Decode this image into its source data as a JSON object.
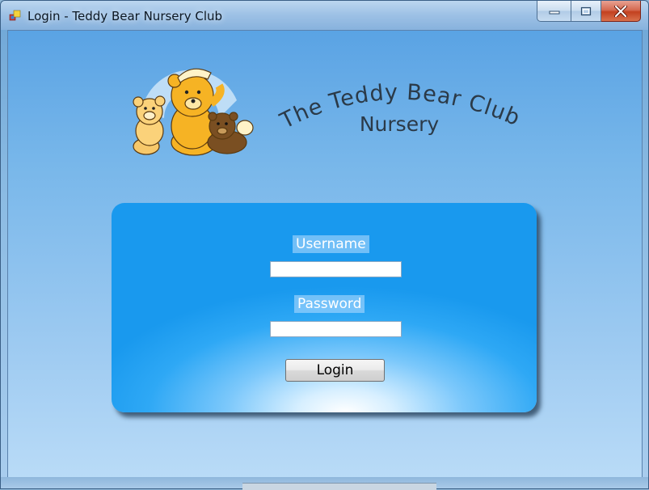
{
  "window": {
    "title": "Login - Teddy Bear Nursery Club",
    "icon": "app-window-icon",
    "controls": {
      "minimize": "minimize-icon",
      "maximize": "maximize-icon",
      "close": "close-icon"
    }
  },
  "logo": {
    "line1": "The Teddy Bear Club",
    "line2": "Nursery"
  },
  "form": {
    "username_label": "Username",
    "username_value": "",
    "password_label": "Password",
    "password_value": "",
    "login_label": "Login"
  },
  "colors": {
    "panel": "#1999ee",
    "bear_yellow": "#f6b324",
    "bear_brown": "#6b4520",
    "logo_text": "#2b3a48"
  }
}
